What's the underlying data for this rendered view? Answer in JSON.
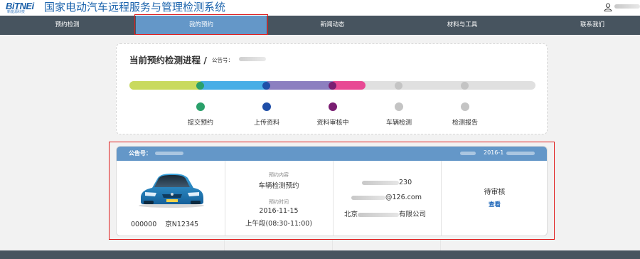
{
  "header": {
    "logo_text": "BiTNEi",
    "logo_sub": "新能源科技",
    "title": "国家电动汽车远程服务与管理检测系统"
  },
  "nav": {
    "items": [
      "预约检测",
      "我的预约",
      "新闻动态",
      "材料与工具",
      "联系我们"
    ],
    "active": "我的预约"
  },
  "progress": {
    "title": "当前预约检测进程 /",
    "notice_label": "公告号：",
    "steps": [
      {
        "label": "提交预约",
        "color": "#2aa06a"
      },
      {
        "label": "上传资料",
        "color": "#1f4fa8"
      },
      {
        "label": "资料审核中",
        "color": "#7a1e72"
      },
      {
        "label": "车辆检测",
        "color": "#c4c4c4"
      },
      {
        "label": "检测报告",
        "color": "#c4c4c4"
      }
    ],
    "bar_colors": [
      "#c9da5e",
      "#48aee6",
      "#8c7fc0",
      "#e84a94",
      "#e0e0e0"
    ],
    "current_step_fraction": 0.57
  },
  "order": {
    "notice_label": "公告号：",
    "date_prefix": "2016-1",
    "plate_code": "000000",
    "plate_no": "京N12345",
    "content_label": "预约内容",
    "content_value": "车辆检测预约",
    "time_label": "预约时间",
    "time_date": "2016-11-15",
    "time_slot": "上午段(08:30-11:00)",
    "phone_suffix": "230",
    "email_suffix": "@126.com",
    "company_prefix": "北京",
    "company_suffix": "有限公司",
    "status": "待审核",
    "view_label": "查看"
  }
}
